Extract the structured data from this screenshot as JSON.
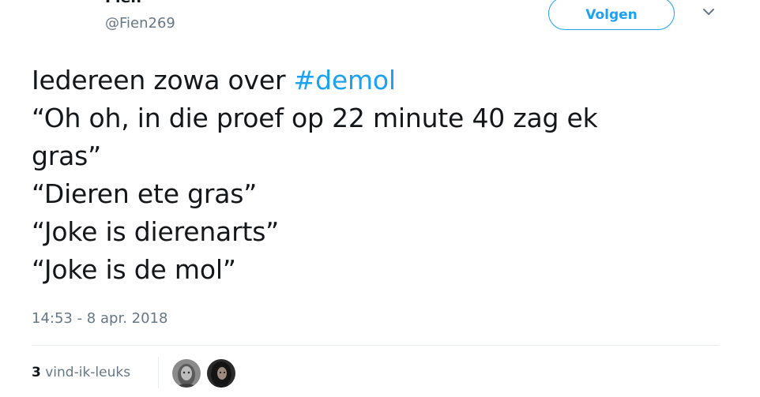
{
  "author": {
    "display_name": "Fien",
    "handle": "@Fien269"
  },
  "follow_button": {
    "label": "Volgen"
  },
  "tweet": {
    "line1_text": "Iedereen zowa over ",
    "hashtag": "#demol",
    "lines": [
      "“Oh oh, in die proef op 22 minute 40 zag ek",
      "gras”",
      "“Dieren ete gras”",
      "“Joke is dierenarts”",
      "“Joke is de mol”"
    ],
    "timestamp": "14:53 - 8 apr. 2018"
  },
  "likes": {
    "count": "3",
    "label": "vind-ik-leuks"
  },
  "icons": {
    "caret": "chevron-down-icon"
  },
  "colors": {
    "accent": "#1da1f2",
    "text": "#14171a",
    "muted": "#657786",
    "divider": "#e6ecf0"
  }
}
